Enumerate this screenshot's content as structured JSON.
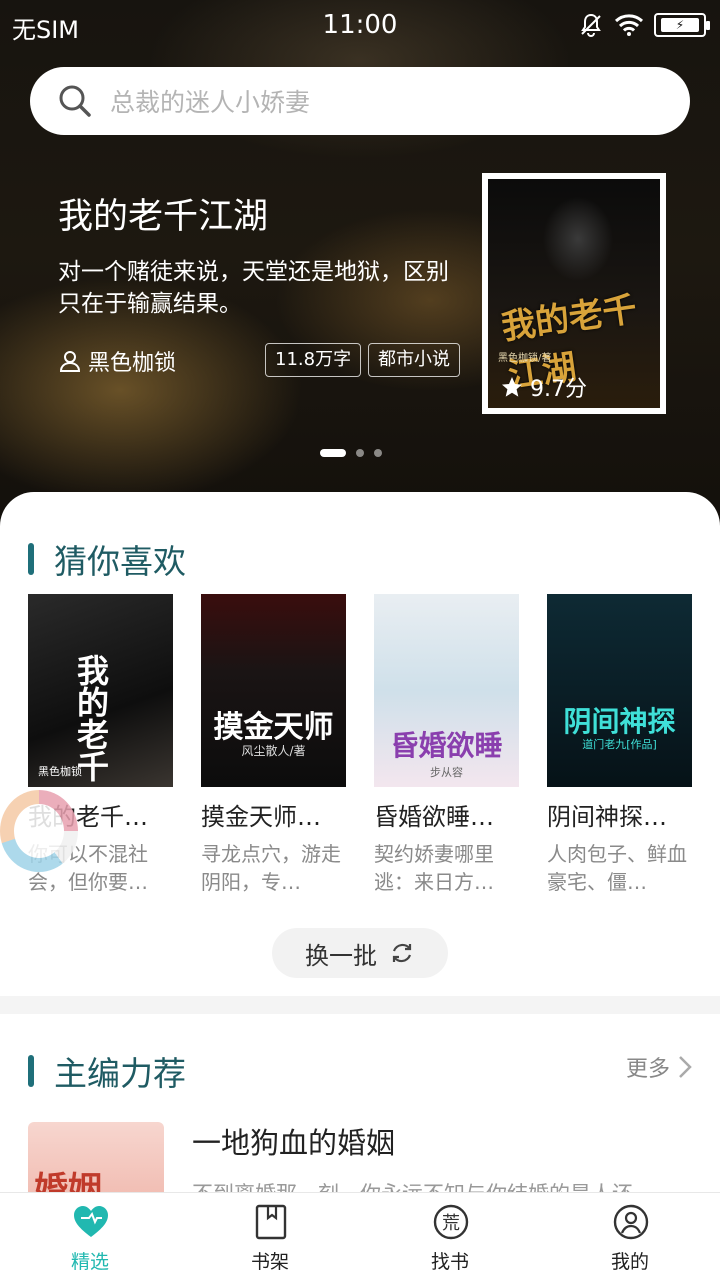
{
  "status_bar": {
    "carrier": "无SIM",
    "time": "11:00"
  },
  "search": {
    "placeholder": "总裁的迷人小娇妻"
  },
  "featured": {
    "title": "我的老千江湖",
    "description": "对一个赌徒来说，天堂还是地狱，区别只在于输赢结果。",
    "author": "黑色枷锁",
    "tags": [
      "11.8万字",
      "都市小说"
    ],
    "rating": "9.7分",
    "cover_title": "我的老千江湖",
    "cover_author": "黑色枷锁/著",
    "carousel_pages": 3,
    "carousel_active": 1
  },
  "guess": {
    "heading": "猜你喜欢",
    "books": [
      {
        "title": "我的老千…",
        "desc": "你可以不混社会，但你要…",
        "cover_text": "我的老千",
        "cover_author": "黑色枷锁"
      },
      {
        "title": "摸金天师…",
        "desc": "寻龙点穴，游走阴阳，专…",
        "cover_text": "摸金天师",
        "cover_author": "风尘散人/著"
      },
      {
        "title": "昏婚欲睡…",
        "desc": "契约娇妻哪里逃：来日方…",
        "cover_text": "昏婚欲睡",
        "cover_author": "步从容"
      },
      {
        "title": "阴间神探…",
        "desc": "人肉包子、鲜血豪宅、僵…",
        "cover_text": "阴间神探",
        "cover_author": "道门老九[作品]"
      }
    ],
    "refresh_label": "换一批"
  },
  "editor": {
    "heading": "主编力荐",
    "more_label": "更多",
    "book": {
      "title": "一地狗血的婚姻",
      "desc": "不到离婚那一刻，你永远不知与你结婚的是人还",
      "cover_text": "婚姻"
    }
  },
  "nav": [
    {
      "label": "精选",
      "icon": "heart-icon",
      "active": true
    },
    {
      "label": "书架",
      "icon": "bookshelf-icon",
      "active": false
    },
    {
      "label": "找书",
      "icon": "find-book-icon",
      "active": false
    },
    {
      "label": "我的",
      "icon": "profile-icon",
      "active": false
    }
  ],
  "colors": {
    "accent": "#21b8b0",
    "section_bar": "#1f6f7a"
  }
}
